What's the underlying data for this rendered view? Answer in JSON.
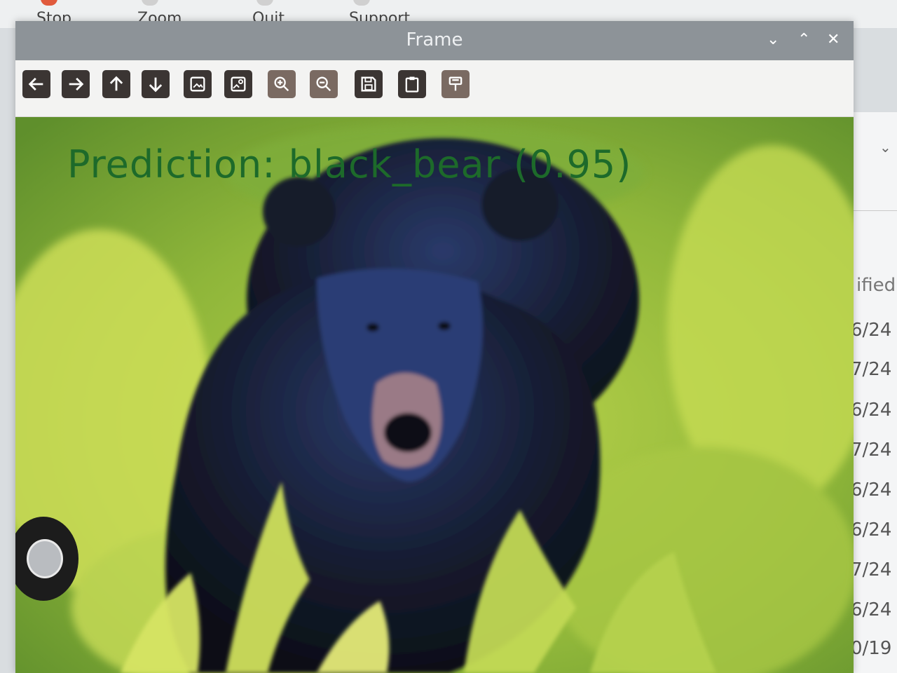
{
  "background_app": {
    "toolbar": [
      "Stop",
      "Zoom",
      "Quit",
      "Support"
    ],
    "column_header": "ified",
    "dates": [
      "6/24",
      "7/24",
      "6/24",
      "7/24",
      "6/24",
      "6/24",
      "7/24",
      "6/24",
      "0/19"
    ]
  },
  "window": {
    "title": "Frame",
    "controls": {
      "minimize": "⌄",
      "maximize": "⌃",
      "close": "✕"
    }
  },
  "toolbar": {
    "buttons": [
      {
        "icon": "arrow-left-icon"
      },
      {
        "icon": "arrow-right-icon"
      },
      {
        "icon": "arrow-up-icon"
      },
      {
        "icon": "arrow-down-icon"
      },
      {
        "icon": "image-icon"
      },
      {
        "icon": "image-settings-icon"
      },
      {
        "icon": "zoom-in-icon"
      },
      {
        "icon": "zoom-out-icon"
      },
      {
        "icon": "save-icon"
      },
      {
        "icon": "clipboard-icon"
      },
      {
        "icon": "paint-icon"
      }
    ]
  },
  "image": {
    "prediction_text": "Prediction: black_bear (0.95)",
    "colors": {
      "prediction": "#1d6a2a",
      "foliage": "#8fb63a",
      "bear": "#141a2c"
    }
  }
}
